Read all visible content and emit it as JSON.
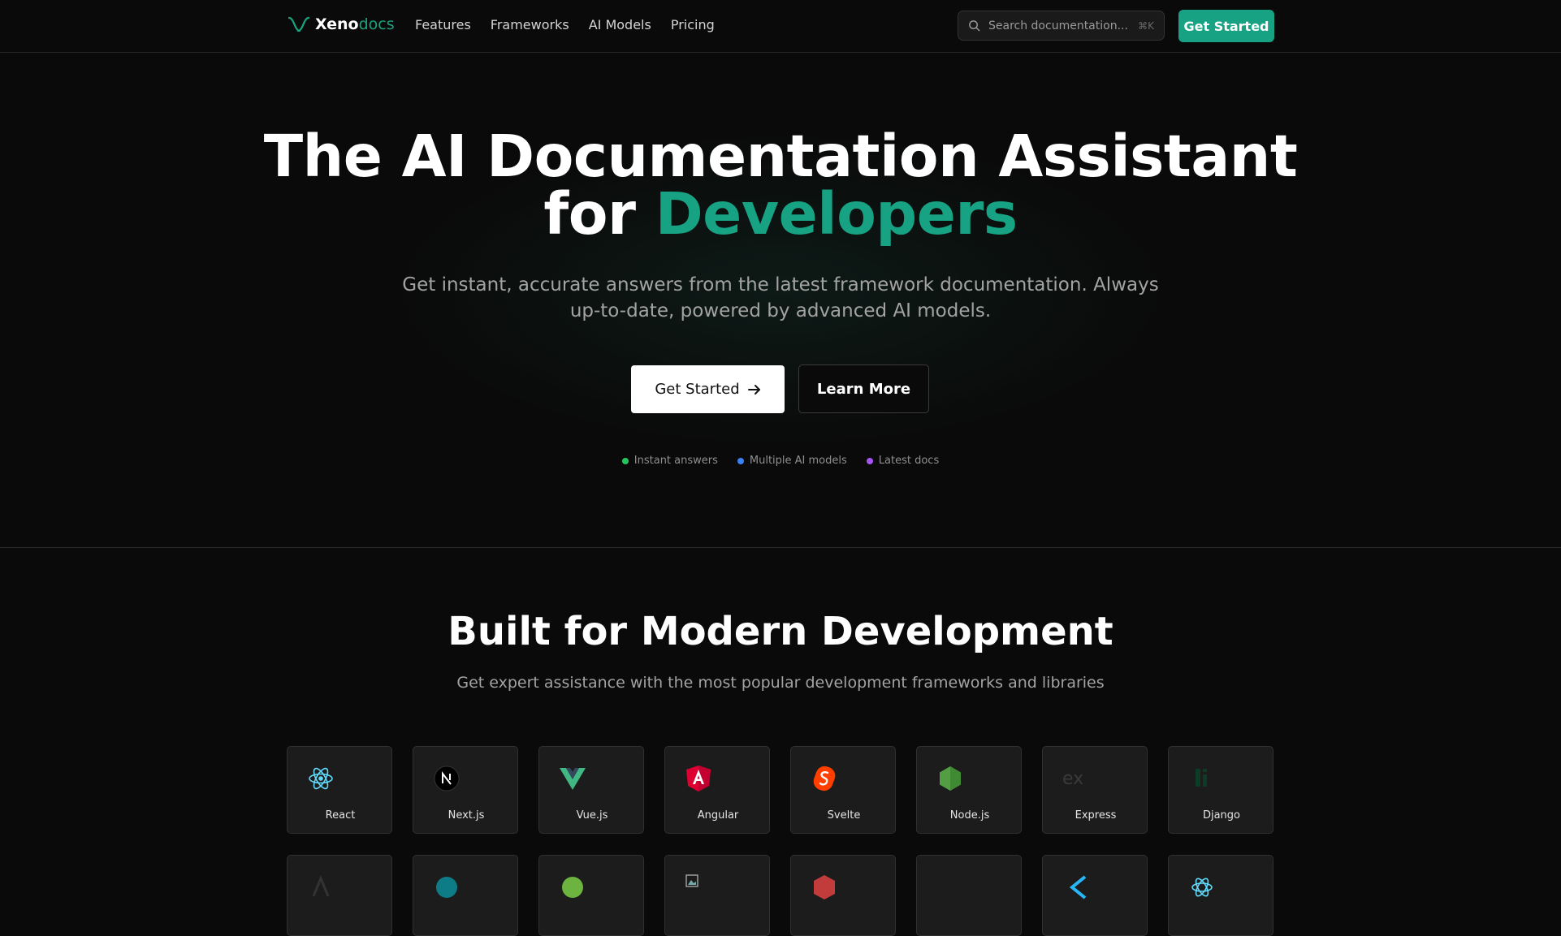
{
  "nav": {
    "logo_main": "Xeno",
    "logo_accent": "docs",
    "links": [
      "Features",
      "Frameworks",
      "AI Models",
      "Pricing"
    ],
    "search_placeholder": "Search documentation...",
    "search_shortcut": "⌘K",
    "cta": "Get Started"
  },
  "hero": {
    "title_line1": "The AI Documentation Assistant",
    "title_for": "for ",
    "title_accent": "Developers",
    "subtitle_line1": "Get instant, accurate answers from the latest framework documentation. Always",
    "subtitle_line2": "up-to-date, powered by advanced AI models.",
    "primary_button": "Get Started",
    "secondary_button": "Learn More",
    "features": [
      {
        "label": "Instant answers",
        "color": "#22c55e"
      },
      {
        "label": "Multiple AI models",
        "color": "#3b82f6"
      },
      {
        "label": "Latest docs",
        "color": "#a855f7"
      }
    ]
  },
  "frameworks": {
    "title": "Built for Modern Development",
    "subtitle": "Get expert assistance with the most popular development frameworks and libraries",
    "items": [
      {
        "label": "React",
        "icon": "react-icon"
      },
      {
        "label": "Next.js",
        "icon": "nextjs-icon"
      },
      {
        "label": "Vue.js",
        "icon": "vue-icon"
      },
      {
        "label": "Angular",
        "icon": "angular-icon"
      },
      {
        "label": "Svelte",
        "icon": "svelte-icon"
      },
      {
        "label": "Node.js",
        "icon": "nodejs-icon"
      },
      {
        "label": "Express",
        "icon": "express-icon",
        "icon_text": "ex"
      },
      {
        "label": "Django",
        "icon": "django-icon"
      }
    ],
    "colors": {
      "accent": "#17a383",
      "card_bg": "#1c1c1c"
    }
  }
}
